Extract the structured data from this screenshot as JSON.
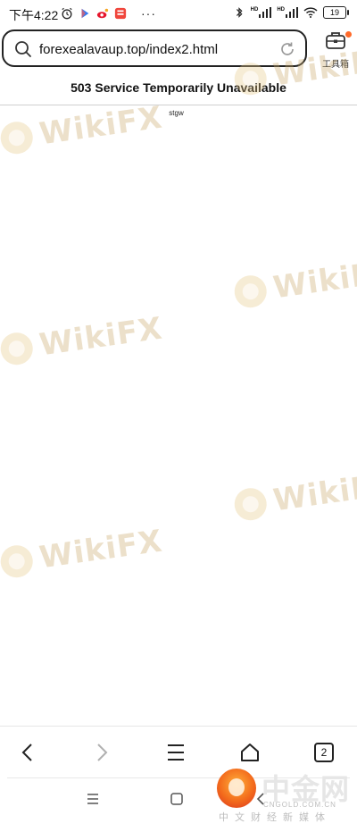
{
  "status_bar": {
    "time": "下午4:22",
    "signal1_label": "HD",
    "signal2_label": "HD",
    "battery": "19",
    "more": "···"
  },
  "browser": {
    "url": "forexealavaup.top/index2.html",
    "toolbox_label": "工具箱",
    "tab_count": "2"
  },
  "page": {
    "title": "503 Service Temporarily Unavailable",
    "server": "stgw"
  },
  "watermarks": {
    "wikifx": "WikiFX",
    "cngold_title": "中金网",
    "cngold_domain": "CNGOLD.COM.CN",
    "cngold_sub": "中文财经新媒体"
  },
  "colors": {
    "accent_dot": "#ff6a2a",
    "watermark": "#c9a86b"
  }
}
